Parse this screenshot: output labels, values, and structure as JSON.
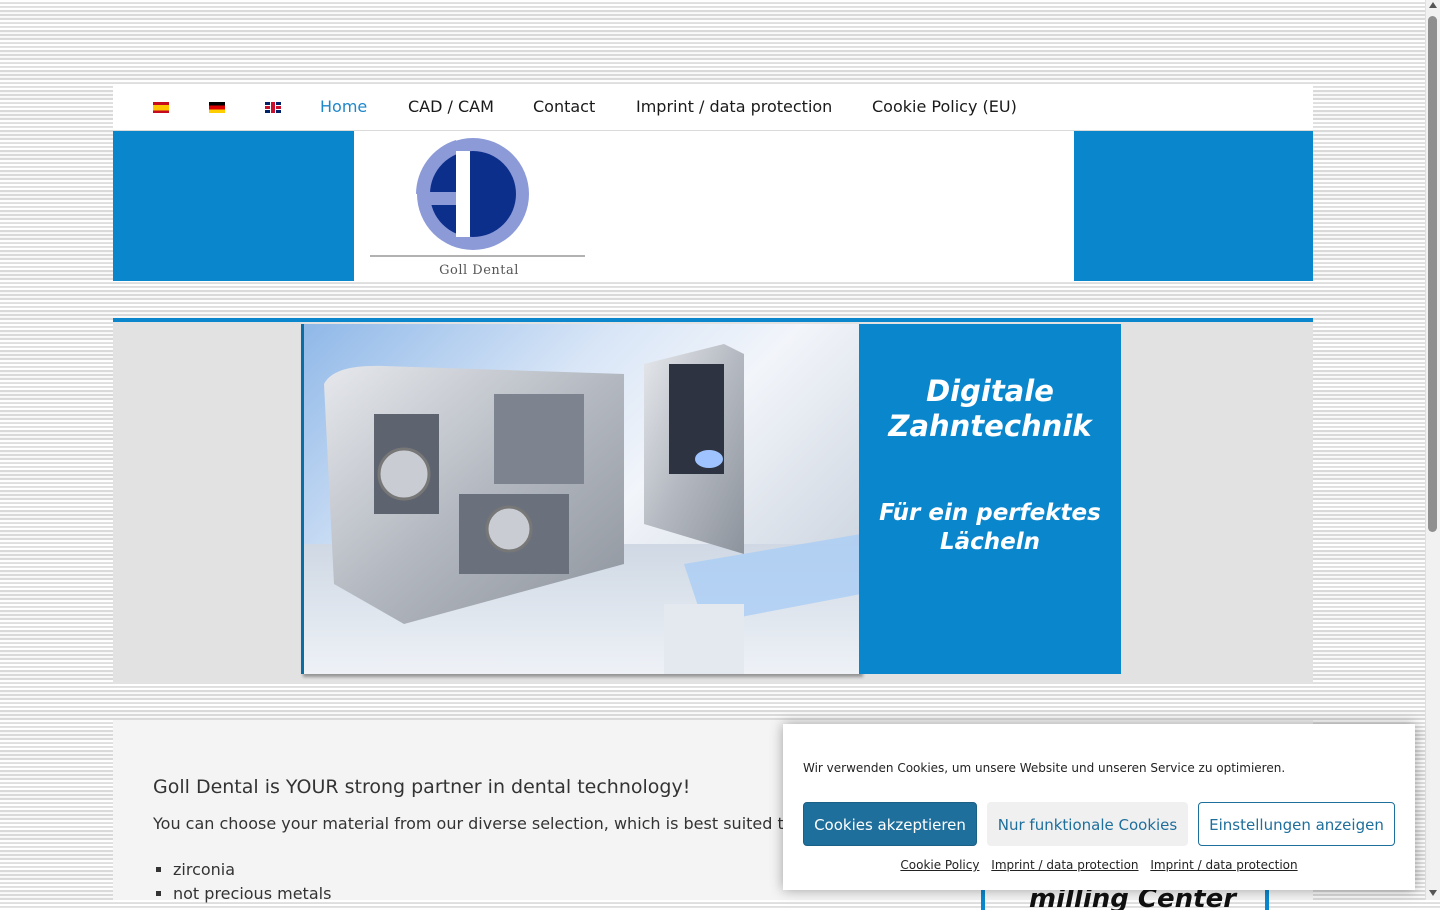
{
  "nav": {
    "flags": [
      "es",
      "de",
      "gb"
    ],
    "items": [
      {
        "label": "Home",
        "active": true
      },
      {
        "label": "CAD / CAM",
        "active": false
      },
      {
        "label": "Contact",
        "active": false
      },
      {
        "label": "Imprint / data protection",
        "active": false
      },
      {
        "label": "Cookie Policy (EU)",
        "active": false
      }
    ]
  },
  "header": {
    "logo_text": "Goll Dental",
    "accent_color": "#0a87cc"
  },
  "slider": {
    "title": "Digitale Zahntechnik",
    "subtitle": "Für ein perfektes Lächeln"
  },
  "content": {
    "heading": "Goll Dental is YOUR strong partner in dental technology!",
    "paragraph": "You can choose your material from our diverse selection, which is best suited t",
    "materials": [
      "zirconia",
      "not precious metals"
    ],
    "milling_label": "milling Center"
  },
  "cookie_banner": {
    "message": "Wir verwenden Cookies, um unsere Website und unseren Service zu optimieren.",
    "accept_label": "Cookies akzeptieren",
    "functional_label": "Nur funktionale Cookies",
    "settings_label": "Einstellungen anzeigen",
    "links": [
      "Cookie Policy",
      "Imprint / data protection",
      "Imprint / data protection"
    ]
  }
}
